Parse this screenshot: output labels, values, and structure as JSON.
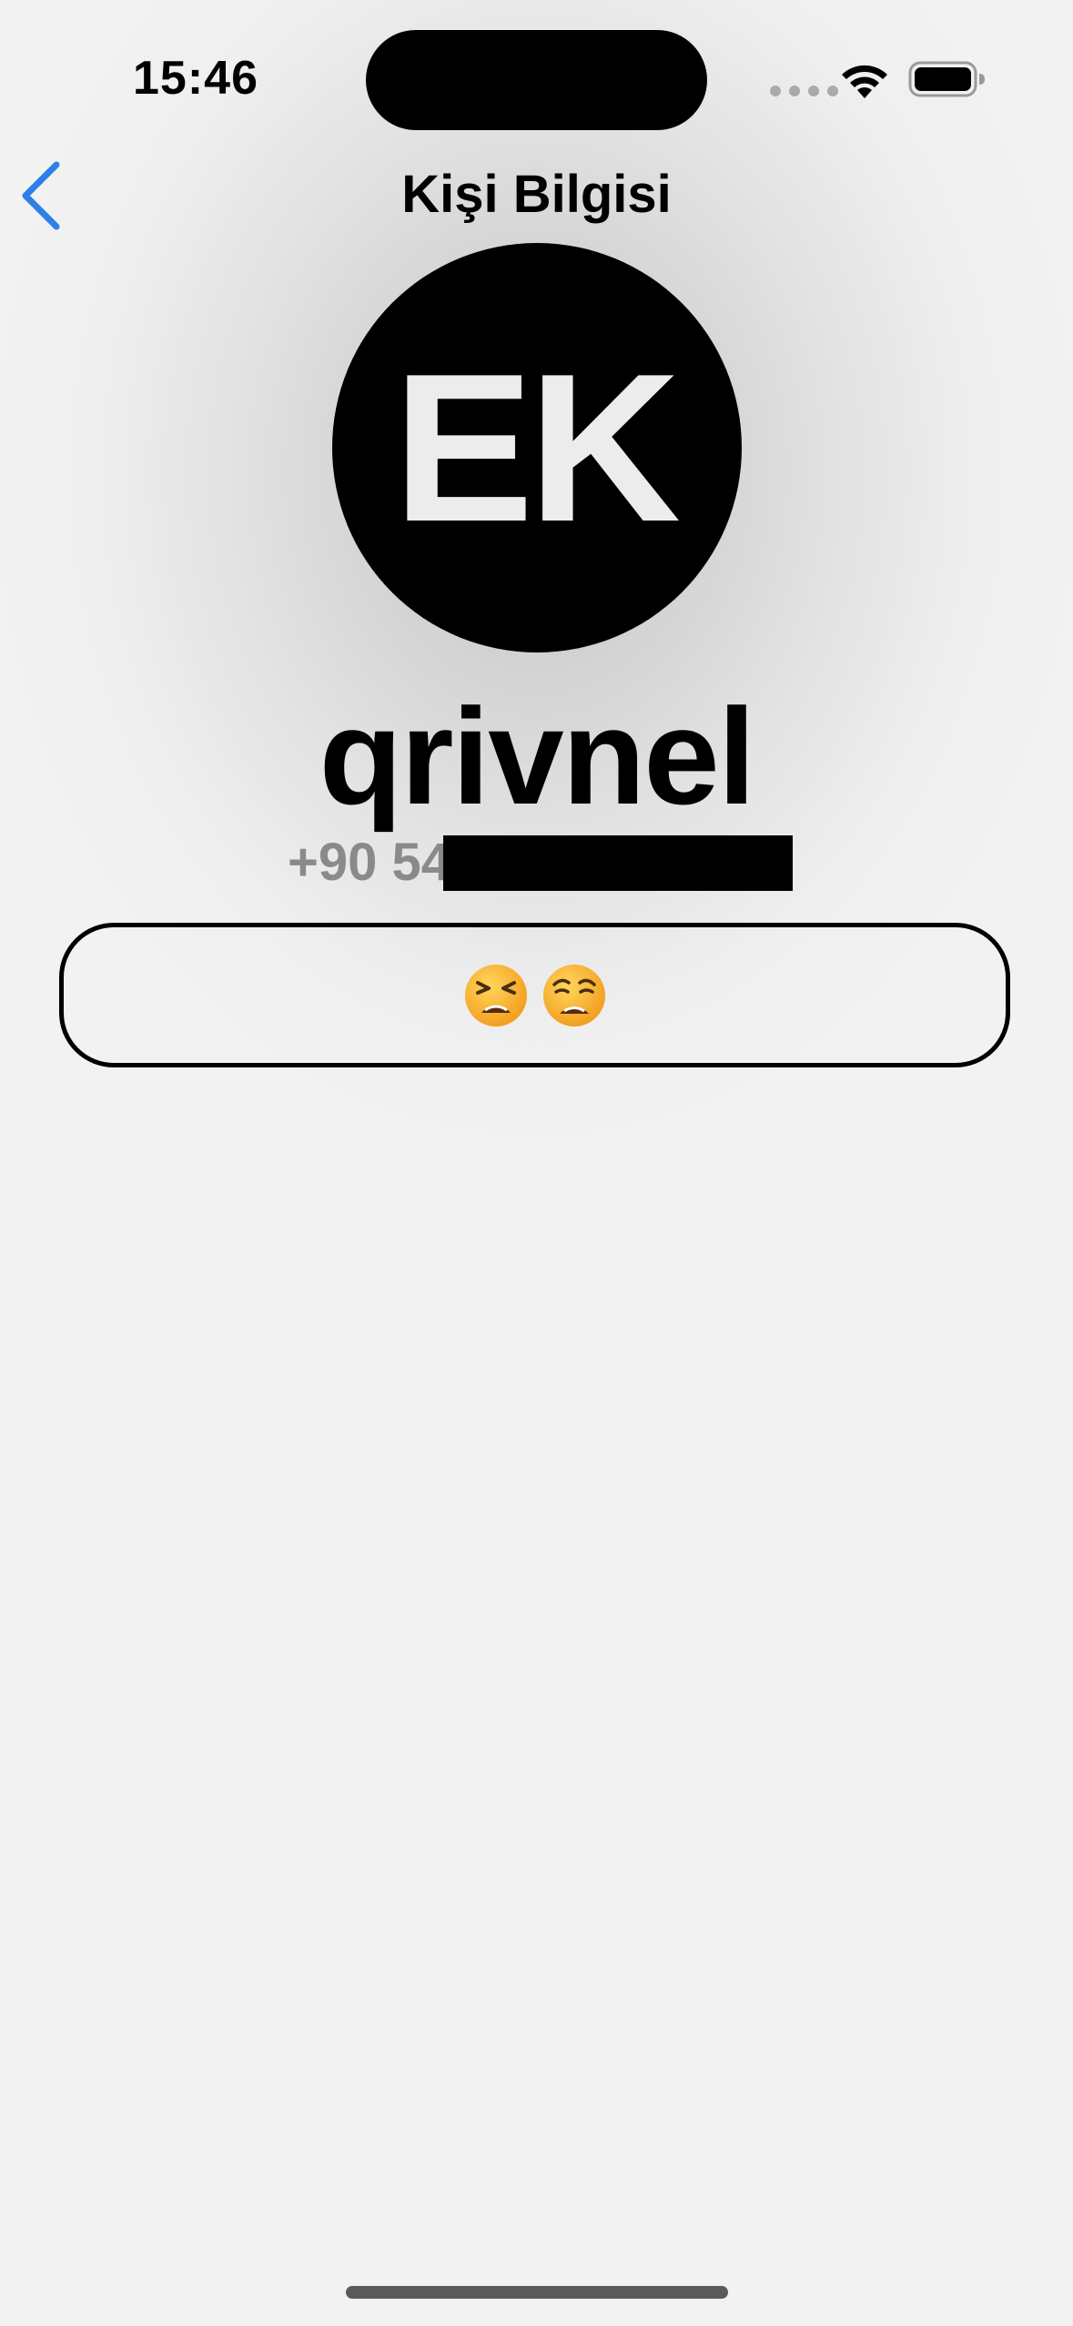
{
  "status_bar": {
    "time": "15:46",
    "icons": [
      "signal-dots-icon",
      "wifi-icon",
      "battery-icon"
    ]
  },
  "nav": {
    "back_icon": "chevron-left-icon",
    "title": "Kişi Bilgisi"
  },
  "contact": {
    "avatar_initials": "EK",
    "name": "qrivnel",
    "phone_visible": "+90 54"
  },
  "status": {
    "emojis": [
      "tired-face-emoji",
      "weary-face-emoji"
    ]
  },
  "colors": {
    "accent": "#2f7fe6",
    "avatar_bg": "#000000",
    "avatar_text": "#ececec",
    "phone_text": "#8a8a8a",
    "background": "#f2f2f2"
  }
}
